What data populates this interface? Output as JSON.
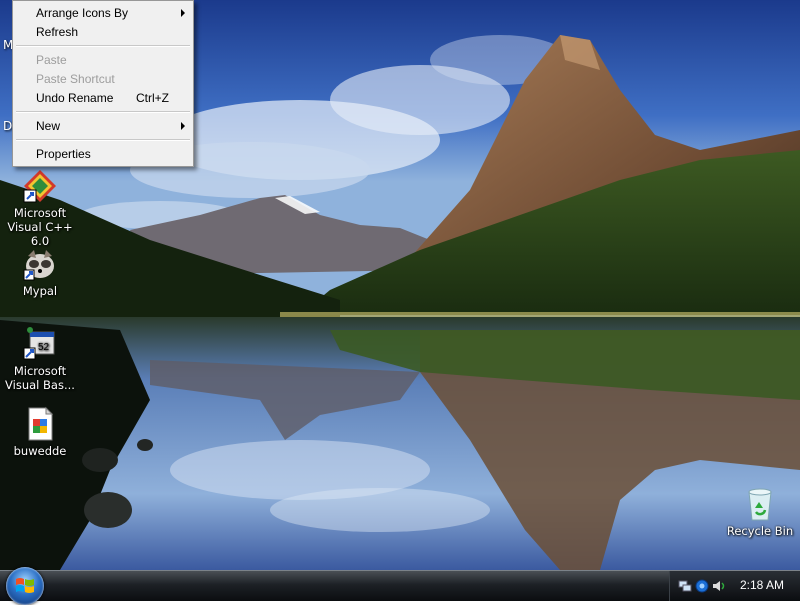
{
  "context_menu": {
    "items": [
      {
        "label": "Arrange Icons By",
        "submenu": true
      },
      {
        "label": "Refresh"
      },
      {
        "label": "Paste",
        "disabled": true
      },
      {
        "label": "Paste Shortcut",
        "disabled": true
      },
      {
        "label": "Undo Rename",
        "shortcut": "Ctrl+Z"
      },
      {
        "label": "New",
        "submenu": true
      },
      {
        "label": "Properties"
      }
    ]
  },
  "desktop": {
    "partial_labels": [
      "M",
      "D"
    ],
    "icons": [
      {
        "label": "Microsoft Visual C++ 6.0",
        "icon": "visual-cpp-icon"
      },
      {
        "label": "Mypal",
        "icon": "mypal-browser-icon"
      },
      {
        "label": "Microsoft Visual Bas...",
        "icon": "visual-basic-icon"
      },
      {
        "label": "buwedde",
        "icon": "document-icon"
      },
      {
        "label": "Recycle Bin",
        "icon": "recycle-bin-icon"
      }
    ]
  },
  "taskbar": {
    "clock": "2:18 AM"
  }
}
